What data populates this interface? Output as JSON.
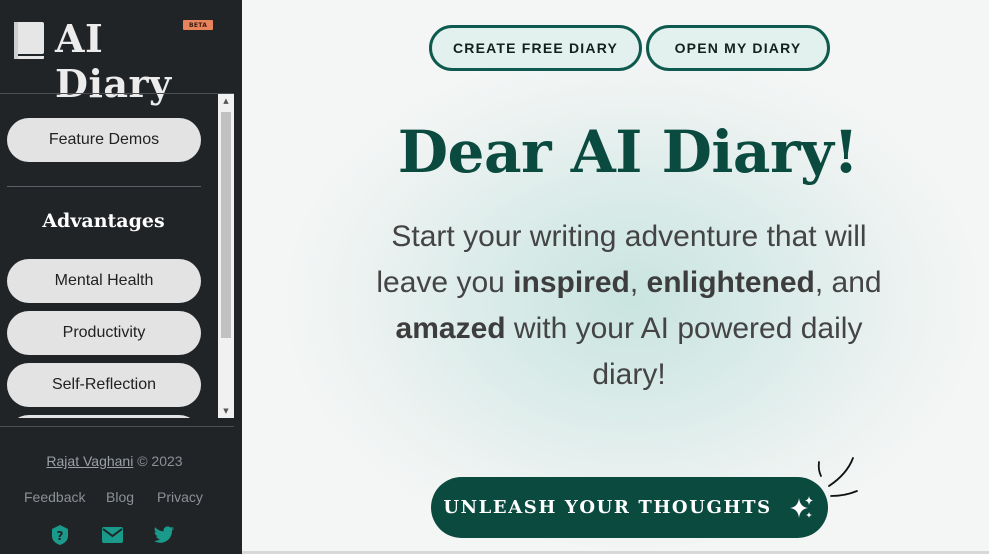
{
  "sidebar": {
    "logo": {
      "title": "AI Diary",
      "badge": "BETA",
      "icon": "book-icon"
    },
    "nav": {
      "feature_demos": "Feature Demos",
      "advantages_heading": "Advantages",
      "items": [
        {
          "label": "Mental Health"
        },
        {
          "label": "Productivity"
        },
        {
          "label": "Self-Reflection"
        }
      ]
    },
    "footer": {
      "author": "Rajat Vaghani",
      "copyright": " © 2023",
      "links": [
        "Feedback",
        "Blog",
        "Privacy"
      ],
      "social_icons": [
        "help-icon",
        "email-icon",
        "twitter-icon"
      ]
    }
  },
  "main": {
    "buttons": {
      "create": "CREATE FREE DIARY",
      "open": "OPEN MY DIARY"
    },
    "title": "Dear AI Diary!",
    "subtitle_parts": {
      "p1": "Start your writing adventure that will leave you ",
      "b1": "inspired",
      "p2": ", ",
      "b2": "enlightened",
      "p3": ", and ",
      "b3": "amazed",
      "p4": " with your AI powered daily diary!"
    },
    "cta": "UNLEASH YOUR THOUGHTS",
    "cta_icon": "sparkles-icon"
  },
  "colors": {
    "sidebar_bg": "#212427",
    "brand_green": "#0b4a3f",
    "accent_teal": "#1a9a8a",
    "beta_badge": "#e8835b"
  }
}
